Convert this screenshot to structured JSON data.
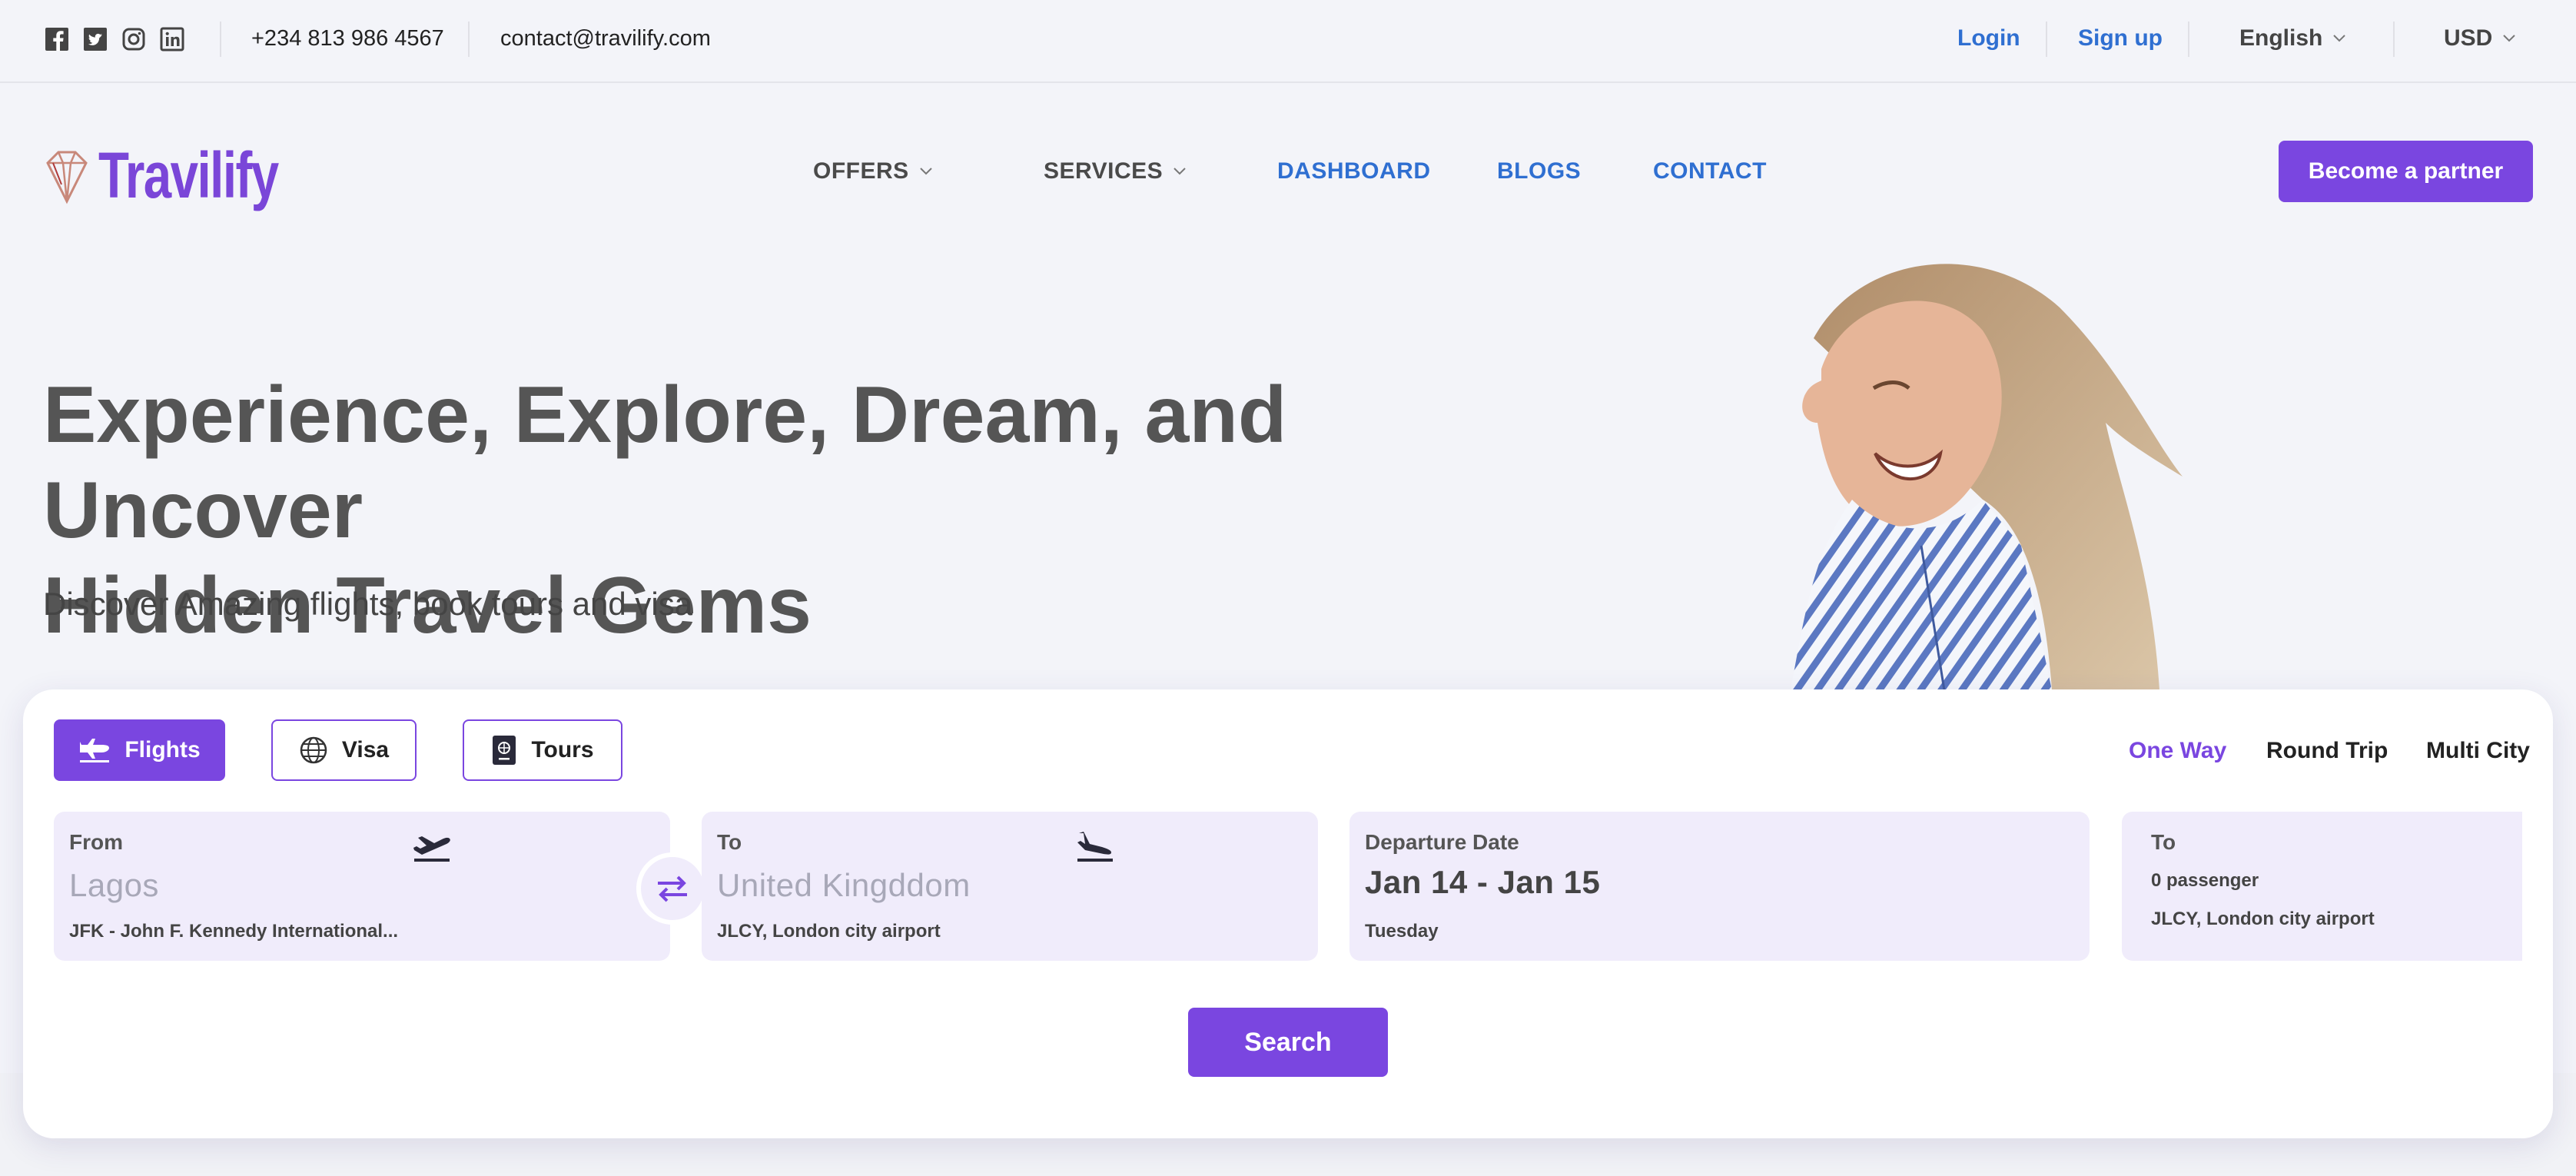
{
  "topbar": {
    "socials": [
      "facebook-icon",
      "twitter-icon",
      "instagram-icon",
      "linkedin-icon"
    ],
    "phone": "+234 813 986 4567",
    "email": "contact@travilify.com",
    "login": "Login",
    "signup": "Sign up",
    "language": "English",
    "currency": "USD"
  },
  "brand": {
    "name": "Travilify",
    "color": "#7a46d8"
  },
  "nav": {
    "offers": "OFFERS",
    "services": "SERVICES",
    "dashboard": "DASHBOARD",
    "blogs": "BLOGS",
    "contact": "CONTACT",
    "partner_button": "Become a partner"
  },
  "hero": {
    "title_line1": "Experience, Explore, Dream, and Uncover",
    "title_line2": "Hidden Travel Gems",
    "subtitle": "Discover Amazing flights, book tours and visa"
  },
  "search": {
    "tabs": [
      {
        "label": "Flights",
        "icon": "airplane-icon",
        "active": true
      },
      {
        "label": "Visa",
        "icon": "globe-icon",
        "active": false
      },
      {
        "label": "Tours",
        "icon": "passport-icon",
        "active": false
      }
    ],
    "trip_types": [
      {
        "label": "One Way",
        "active": true
      },
      {
        "label": "Round Trip",
        "active": false
      },
      {
        "label": "Multi City",
        "active": false
      }
    ],
    "from": {
      "label": "From",
      "value": "Lagos",
      "detail": "JFK - John F. Kennedy International..."
    },
    "to": {
      "label": "To",
      "value": "United Kingddom",
      "detail": "JLCY, London city airport"
    },
    "departure": {
      "label": "Departure Date",
      "value": "Jan 14 - Jan 15",
      "detail": "Tuesday"
    },
    "passengers": {
      "label": "To",
      "count": "0 passenger",
      "detail": "JLCY, London city airport"
    },
    "search_button": "Search"
  },
  "colors": {
    "accent": "#7a46e0",
    "link": "#2f6fd1",
    "field_bg": "#f0ecfb"
  }
}
